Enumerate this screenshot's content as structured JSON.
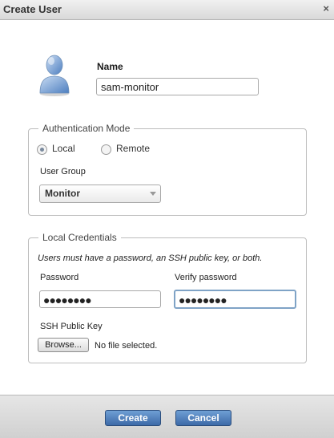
{
  "window": {
    "title": "Create User",
    "close_glyph": "×"
  },
  "user": {
    "icon": "user-avatar-icon",
    "name_label": "Name",
    "name_value": "sam-monitor"
  },
  "auth_mode": {
    "legend": "Authentication Mode",
    "options": [
      {
        "label": "Local",
        "selected": true
      },
      {
        "label": "Remote",
        "selected": false
      }
    ],
    "user_group_label": "User Group",
    "user_group_value": "Monitor"
  },
  "credentials": {
    "legend": "Local Credentials",
    "note": "Users must have a password, an SSH public key, or both.",
    "password_label": "Password",
    "password_mask": "●●●●●●●●",
    "verify_label": "Verify password",
    "verify_mask": "●●●●●●●●",
    "ssh_label": "SSH Public Key",
    "browse_label": "Browse...",
    "file_status": "No file selected."
  },
  "footer": {
    "create_label": "Create",
    "cancel_label": "Cancel"
  },
  "colors": {
    "primary_button": "#4f7fbf",
    "focus_border": "#7fa3c6"
  }
}
